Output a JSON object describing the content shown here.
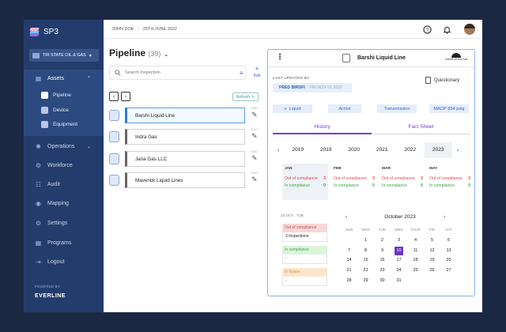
{
  "app": {
    "name": "SP3",
    "org": "TRI STATE OIL & GAS",
    "powered_by": "POWERED BY",
    "brand": "EVERLINE"
  },
  "sidebar": {
    "assets": "Assets",
    "sub_items": [
      "Pipeline",
      "Device",
      "Equipment"
    ],
    "items": [
      "Operations",
      "Workforce",
      "Audit",
      "Mapping",
      "Settings",
      "Programs",
      "Logout"
    ]
  },
  "topbar": {
    "user": "JOHN DOE",
    "date": "25TH JUNE 2022"
  },
  "list": {
    "title": "Pipeline",
    "count": "(39)",
    "search_placeholder": "Search Inspection",
    "add_label": "Add",
    "refresh_label": "Refresh",
    "edit_label": "EDIT",
    "rows": [
      "Barshi Liquid Line",
      "Indra Gas",
      "Jaria Gas LLC",
      "Maverick Liquid Lines"
    ]
  },
  "detail": {
    "name": "Barshi Liquid Line",
    "logo_text": "Gabriel Oil And Gas",
    "last_updated_label": "LAST UPDATED BY",
    "updated_by": "FRED BIRDFI",
    "updated_date": ": FRI NOV 01 2022",
    "questionary": "Questionary",
    "tags": [
      "Liquid",
      "Active",
      "Transmission",
      "MAOP 654 psig"
    ],
    "tabs": [
      "History",
      "Fact Sheet"
    ],
    "years": [
      "2019",
      "2019",
      "2020",
      "2021",
      "2022",
      "2023"
    ],
    "months": [
      {
        "name": "JAN",
        "out": 3,
        "in": 0
      },
      {
        "name": "FEB",
        "out": 3,
        "in": 0
      },
      {
        "name": "MAR",
        "out": 3,
        "in": 0
      },
      {
        "name": "MAY",
        "out": 3,
        "in": 0
      }
    ],
    "out_label": "Out of compliance",
    "in_label": "In compliance",
    "selected_date": "23 OCT , TUE",
    "stats": [
      {
        "label": "Out of compliance",
        "value": "3 Inspections",
        "color": "#f6d8d8",
        "text": "#d14a4a"
      },
      {
        "label": "In compliance",
        "value": "-",
        "color": "#dcf3dc",
        "text": "#3aa64b"
      },
      {
        "label": "In Grace",
        "value": "-",
        "color": "#fbe6cc",
        "text": "#d98a2b"
      }
    ],
    "calendar": {
      "title": "October 2023",
      "weekdays": [
        "SUN",
        "MON",
        "TUE",
        "WED",
        "THUR",
        "FRI",
        "SAT"
      ],
      "weeks": [
        [
          "",
          "1",
          "2",
          "3",
          "4",
          "5",
          "6"
        ],
        [
          "7",
          "8",
          "9",
          "10",
          "11",
          "12",
          "13"
        ],
        [
          "14",
          "15",
          "16",
          "17",
          "18",
          "19",
          "20"
        ],
        [
          "21",
          "22",
          "23",
          "24",
          "25",
          "26",
          "27"
        ],
        [
          "28",
          "29",
          "30",
          "31",
          "",
          "",
          ""
        ]
      ],
      "today": "10"
    }
  },
  "colors": {
    "sidebar": "#233c6b",
    "accent": "#7c3bd1",
    "link": "#2b6bd1"
  }
}
